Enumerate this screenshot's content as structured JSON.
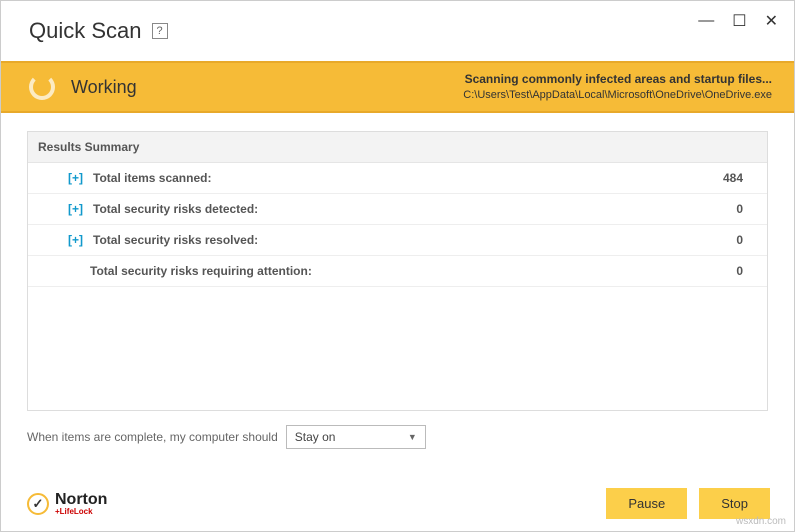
{
  "window": {
    "title": "Quick Scan",
    "help": "?"
  },
  "status": {
    "label": "Working",
    "line1": "Scanning commonly infected areas and startup files...",
    "line2": "C:\\Users\\Test\\AppData\\Local\\Microsoft\\OneDrive\\OneDrive.exe"
  },
  "results": {
    "header": "Results Summary",
    "expandIcon": "[+]",
    "rows": {
      "scanned": {
        "label": "Total items scanned:",
        "value": "484"
      },
      "detected": {
        "label": "Total security risks detected:",
        "value": "0"
      },
      "resolved": {
        "label": "Total security risks resolved:",
        "value": "0"
      },
      "attention": {
        "label": "Total security risks requiring attention:",
        "value": "0"
      }
    }
  },
  "complete": {
    "prefix": "When items are complete, my computer should",
    "selected": "Stay on"
  },
  "logo": {
    "main": "Norton",
    "sub": "+LifeLock"
  },
  "buttons": {
    "pause": "Pause",
    "stop": "Stop"
  },
  "watermark": "wsxdn.com"
}
